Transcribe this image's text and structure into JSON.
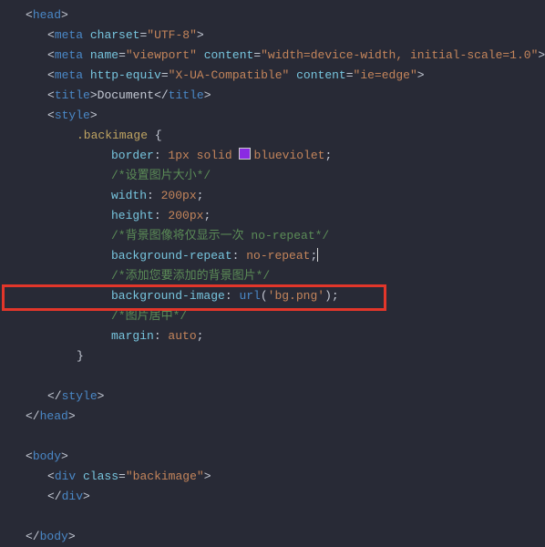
{
  "lines": {
    "head_open": "head",
    "meta_charset_attr": "charset",
    "meta_charset_val": "\"UTF-8\"",
    "meta_viewport_name": "name",
    "meta_viewport_name_v": "\"viewport\"",
    "meta_viewport_content": "content",
    "meta_viewport_content_v": "\"width=device-width, initial-scale=1.0\"",
    "meta_equiv": "http-equiv",
    "meta_equiv_v": "\"X-UA-Compatible\"",
    "meta_equiv_content": "content",
    "meta_equiv_content_v": "\"ie=edge\"",
    "title_tag": "title",
    "title_text": "Document",
    "style_tag": "style",
    "selector": ".backimage",
    "border_p": "border",
    "border_v1": "1px",
    "border_v2": "solid",
    "border_v3": "blueviolet",
    "c1": "/*设置图片大小*/",
    "width_p": "width",
    "width_v": "200px",
    "height_p": "height",
    "height_v": "200px",
    "c2": "/*背景图像将仅显示一次 no-repeat*/",
    "bgrepeat_p": "background-repeat",
    "bgrepeat_v": "no-repeat",
    "c3": "/*添加您要添加的背景图片*/",
    "bgimage_p": "background-image",
    "bgimage_v": "url",
    "bgimage_arg": "'bg.png'",
    "c4": "/*图片居中*/",
    "margin_p": "margin",
    "margin_v": "auto",
    "body_tag": "body",
    "div_tag": "div",
    "class_attr": "class",
    "class_v": "\"backimage\""
  },
  "highlight_line_index": 14
}
